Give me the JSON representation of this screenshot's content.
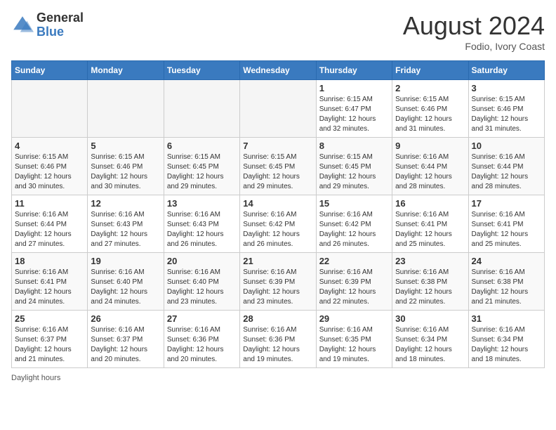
{
  "header": {
    "logo_general": "General",
    "logo_blue": "Blue",
    "month_year": "August 2024",
    "location": "Fodio, Ivory Coast"
  },
  "calendar": {
    "weekdays": [
      "Sunday",
      "Monday",
      "Tuesday",
      "Wednesday",
      "Thursday",
      "Friday",
      "Saturday"
    ],
    "weeks": [
      [
        {
          "day": "",
          "empty": true
        },
        {
          "day": "",
          "empty": true
        },
        {
          "day": "",
          "empty": true
        },
        {
          "day": "",
          "empty": true
        },
        {
          "day": "1",
          "sunrise": "6:15 AM",
          "sunset": "6:47 PM",
          "daylight": "12 hours and 32 minutes."
        },
        {
          "day": "2",
          "sunrise": "6:15 AM",
          "sunset": "6:46 PM",
          "daylight": "12 hours and 31 minutes."
        },
        {
          "day": "3",
          "sunrise": "6:15 AM",
          "sunset": "6:46 PM",
          "daylight": "12 hours and 31 minutes."
        }
      ],
      [
        {
          "day": "4",
          "sunrise": "6:15 AM",
          "sunset": "6:46 PM",
          "daylight": "12 hours and 30 minutes."
        },
        {
          "day": "5",
          "sunrise": "6:15 AM",
          "sunset": "6:46 PM",
          "daylight": "12 hours and 30 minutes."
        },
        {
          "day": "6",
          "sunrise": "6:15 AM",
          "sunset": "6:45 PM",
          "daylight": "12 hours and 29 minutes."
        },
        {
          "day": "7",
          "sunrise": "6:15 AM",
          "sunset": "6:45 PM",
          "daylight": "12 hours and 29 minutes."
        },
        {
          "day": "8",
          "sunrise": "6:15 AM",
          "sunset": "6:45 PM",
          "daylight": "12 hours and 29 minutes."
        },
        {
          "day": "9",
          "sunrise": "6:16 AM",
          "sunset": "6:44 PM",
          "daylight": "12 hours and 28 minutes."
        },
        {
          "day": "10",
          "sunrise": "6:16 AM",
          "sunset": "6:44 PM",
          "daylight": "12 hours and 28 minutes."
        }
      ],
      [
        {
          "day": "11",
          "sunrise": "6:16 AM",
          "sunset": "6:44 PM",
          "daylight": "12 hours and 27 minutes."
        },
        {
          "day": "12",
          "sunrise": "6:16 AM",
          "sunset": "6:43 PM",
          "daylight": "12 hours and 27 minutes."
        },
        {
          "day": "13",
          "sunrise": "6:16 AM",
          "sunset": "6:43 PM",
          "daylight": "12 hours and 26 minutes."
        },
        {
          "day": "14",
          "sunrise": "6:16 AM",
          "sunset": "6:42 PM",
          "daylight": "12 hours and 26 minutes."
        },
        {
          "day": "15",
          "sunrise": "6:16 AM",
          "sunset": "6:42 PM",
          "daylight": "12 hours and 26 minutes."
        },
        {
          "day": "16",
          "sunrise": "6:16 AM",
          "sunset": "6:41 PM",
          "daylight": "12 hours and 25 minutes."
        },
        {
          "day": "17",
          "sunrise": "6:16 AM",
          "sunset": "6:41 PM",
          "daylight": "12 hours and 25 minutes."
        }
      ],
      [
        {
          "day": "18",
          "sunrise": "6:16 AM",
          "sunset": "6:41 PM",
          "daylight": "12 hours and 24 minutes."
        },
        {
          "day": "19",
          "sunrise": "6:16 AM",
          "sunset": "6:40 PM",
          "daylight": "12 hours and 24 minutes."
        },
        {
          "day": "20",
          "sunrise": "6:16 AM",
          "sunset": "6:40 PM",
          "daylight": "12 hours and 23 minutes."
        },
        {
          "day": "21",
          "sunrise": "6:16 AM",
          "sunset": "6:39 PM",
          "daylight": "12 hours and 23 minutes."
        },
        {
          "day": "22",
          "sunrise": "6:16 AM",
          "sunset": "6:39 PM",
          "daylight": "12 hours and 22 minutes."
        },
        {
          "day": "23",
          "sunrise": "6:16 AM",
          "sunset": "6:38 PM",
          "daylight": "12 hours and 22 minutes."
        },
        {
          "day": "24",
          "sunrise": "6:16 AM",
          "sunset": "6:38 PM",
          "daylight": "12 hours and 21 minutes."
        }
      ],
      [
        {
          "day": "25",
          "sunrise": "6:16 AM",
          "sunset": "6:37 PM",
          "daylight": "12 hours and 21 minutes."
        },
        {
          "day": "26",
          "sunrise": "6:16 AM",
          "sunset": "6:37 PM",
          "daylight": "12 hours and 20 minutes."
        },
        {
          "day": "27",
          "sunrise": "6:16 AM",
          "sunset": "6:36 PM",
          "daylight": "12 hours and 20 minutes."
        },
        {
          "day": "28",
          "sunrise": "6:16 AM",
          "sunset": "6:36 PM",
          "daylight": "12 hours and 19 minutes."
        },
        {
          "day": "29",
          "sunrise": "6:16 AM",
          "sunset": "6:35 PM",
          "daylight": "12 hours and 19 minutes."
        },
        {
          "day": "30",
          "sunrise": "6:16 AM",
          "sunset": "6:34 PM",
          "daylight": "12 hours and 18 minutes."
        },
        {
          "day": "31",
          "sunrise": "6:16 AM",
          "sunset": "6:34 PM",
          "daylight": "12 hours and 18 minutes."
        }
      ]
    ]
  },
  "footer": {
    "note": "Daylight hours"
  }
}
